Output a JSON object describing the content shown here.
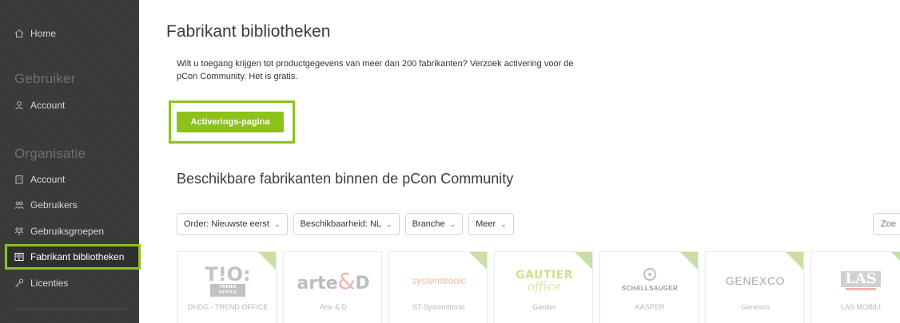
{
  "sidebar": {
    "home": {
      "label": "Home",
      "icon": "home-icon"
    },
    "section_user": "Gebruiker",
    "user_account": {
      "label": "Account",
      "icon": "user-icon"
    },
    "section_org": "Organisatie",
    "org_account": {
      "label": "Account",
      "icon": "building-icon"
    },
    "users": {
      "label": "Gebruikers",
      "icon": "users-icon"
    },
    "user_groups": {
      "label": "Gebruiksgroepen",
      "icon": "user-groups-icon"
    },
    "manufacturer_libraries": {
      "label": "Fabrikant bibliotheken",
      "icon": "library-icon",
      "active": true
    },
    "licenses": {
      "label": "Licenties",
      "icon": "key-icon"
    }
  },
  "main": {
    "title": "Fabrikant bibliotheken",
    "intro": "Wilt u toegang krijgen tot productgegevens van meer dan 200 fabrikanten? Verzoek activering voor de pCon Community. Het is gratis.",
    "cta_label": "Activerings-pagina",
    "section_title": "Beschikbare fabrikanten binnen de pCon Community",
    "filters": [
      {
        "label": "Order: Nieuwste eerst"
      },
      {
        "label": "Beschikbaarheid: NL"
      },
      {
        "label": "Branche"
      },
      {
        "label": "Meer"
      }
    ],
    "search_placeholder": "Zoe"
  },
  "manufacturers": [
    {
      "name": "DHDG - TREND OFFICE",
      "logo_text": "T!O:",
      "logo_sub": "TREND OFFICE"
    },
    {
      "name": "Arte & D",
      "logo_text": "arte",
      "logo_amp": "&",
      "logo_suffix": "D"
    },
    {
      "name": "ST-Systemtronic",
      "logo_text": "systemtronic"
    },
    {
      "name": "Gautier",
      "logo_text": "GAUTIER",
      "logo_sub": "office"
    },
    {
      "name": "KASPER",
      "logo_text": "SCHALLSAUGER"
    },
    {
      "name": "Genexco",
      "logo_text": "GENEXCO"
    },
    {
      "name": "LAS MOBILI",
      "logo_text": "LAS"
    }
  ],
  "colors": {
    "accent": "#8cc21a",
    "sidebar_bg": "#3a3a3a",
    "ribbon": "#c9dfa4"
  }
}
